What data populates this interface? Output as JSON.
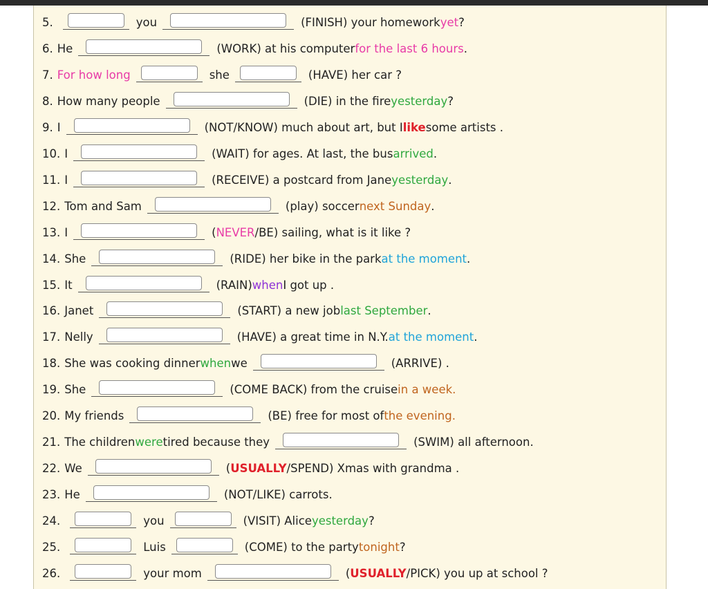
{
  "colors": {
    "pink": "#e83ba7",
    "red": "#e0212b",
    "green": "#2fa83f",
    "brown": "#c0651f",
    "blue": "#1fa3d9",
    "purple": "#8e32d6"
  },
  "exercises": [
    {
      "num": "5.",
      "parts": [
        {
          "blank": true,
          "w": "s"
        },
        {
          "t": "you"
        },
        {
          "blank": true
        },
        {
          "t": "(FINISH)  your homework "
        },
        {
          "t": "yet",
          "c": "pink"
        },
        {
          "t": " ?"
        }
      ]
    },
    {
      "num": "6.",
      "parts": [
        {
          "t": "He"
        },
        {
          "blank": true
        },
        {
          "t": "(WORK)  at his computer "
        },
        {
          "t": "for the last 6 hours",
          "c": "pink"
        },
        {
          "t": " ."
        }
      ]
    },
    {
      "num": "7.",
      "parts": [
        {
          "t": "For how long",
          "c": "pink"
        },
        {
          "blank": true,
          "w": "s"
        },
        {
          "t": "she"
        },
        {
          "blank": true,
          "w": "s"
        },
        {
          "t": "(HAVE)  her car ?"
        }
      ]
    },
    {
      "num": "8.",
      "parts": [
        {
          "t": "How many people"
        },
        {
          "blank": true
        },
        {
          "t": "(DIE)  in the fire "
        },
        {
          "t": "yesterday",
          "c": "green"
        },
        {
          "t": " ?"
        }
      ]
    },
    {
      "num": "9.",
      "parts": [
        {
          "t": "I"
        },
        {
          "blank": true
        },
        {
          "t": "(NOT/KNOW)  much about art, but I "
        },
        {
          "t": "like",
          "c": "red"
        },
        {
          "t": " some artists ."
        }
      ]
    },
    {
      "num": "10.",
      "parts": [
        {
          "t": "I"
        },
        {
          "blank": true
        },
        {
          "t": "(WAIT)  for ages. At last, the bus "
        },
        {
          "t": "arrived",
          "c": "green"
        },
        {
          "t": " ."
        }
      ]
    },
    {
      "num": "11.",
      "parts": [
        {
          "t": "I"
        },
        {
          "blank": true
        },
        {
          "t": "(RECEIVE)  a postcard from Jane "
        },
        {
          "t": "yesterday",
          "c": "green"
        },
        {
          "t": " ."
        }
      ]
    },
    {
      "num": "12.",
      "parts": [
        {
          "t": "Tom and Sam"
        },
        {
          "blank": true
        },
        {
          "t": "(play)  soccer "
        },
        {
          "t": "next Sunday",
          "c": "brown"
        },
        {
          "t": " ."
        }
      ]
    },
    {
      "num": "13.",
      "parts": [
        {
          "t": "I"
        },
        {
          "blank": true
        },
        {
          "t": "("
        },
        {
          "t": "NEVER",
          "c": "pink"
        },
        {
          "t": "/BE)  sailing, what is it like ?"
        }
      ]
    },
    {
      "num": "14.",
      "parts": [
        {
          "t": "She"
        },
        {
          "blank": true
        },
        {
          "t": "(RIDE)  her bike in the park "
        },
        {
          "t": "at the moment",
          "c": "blue"
        },
        {
          "t": " ."
        }
      ]
    },
    {
      "num": "15.",
      "parts": [
        {
          "t": "It"
        },
        {
          "blank": true
        },
        {
          "t": "(RAIN)  "
        },
        {
          "t": "when",
          "c": "purple"
        },
        {
          "t": " I got up ."
        }
      ]
    },
    {
      "num": "16.",
      "parts": [
        {
          "t": "Janet"
        },
        {
          "blank": true
        },
        {
          "t": "(START)  a new job "
        },
        {
          "t": "last September",
          "c": "green"
        },
        {
          "t": " ."
        }
      ]
    },
    {
      "num": "17.",
      "parts": [
        {
          "t": "Nelly"
        },
        {
          "blank": true
        },
        {
          "t": "(HAVE)  a great time in N.Y. "
        },
        {
          "t": "at the moment",
          "c": "blue"
        },
        {
          "t": " ."
        }
      ]
    },
    {
      "num": "18.",
      "parts": [
        {
          "t": "She was cooking dinner "
        },
        {
          "t": "when",
          "c": "green"
        },
        {
          "t": " we"
        },
        {
          "blank": true
        },
        {
          "t": "(ARRIVE) ."
        }
      ]
    },
    {
      "num": "19.",
      "parts": [
        {
          "t": "She"
        },
        {
          "blank": true
        },
        {
          "t": "(COME BACK)  from the cruise "
        },
        {
          "t": "in a week.",
          "c": "brown"
        }
      ]
    },
    {
      "num": "20.",
      "parts": [
        {
          "t": "My friends"
        },
        {
          "blank": true
        },
        {
          "t": "(BE)  free for most of "
        },
        {
          "t": "the evening.",
          "c": "brown"
        }
      ]
    },
    {
      "num": "21.",
      "parts": [
        {
          "t": "The children "
        },
        {
          "t": "were",
          "c": "green"
        },
        {
          "t": " tired because they"
        },
        {
          "blank": true
        },
        {
          "t": "(SWIM)  all afternoon."
        }
      ]
    },
    {
      "num": "22.",
      "parts": [
        {
          "t": "We"
        },
        {
          "blank": true
        },
        {
          "t": "("
        },
        {
          "t": "USUALLY",
          "c": "red"
        },
        {
          "t": "/SPEND)  Xmas with grandma ."
        }
      ]
    },
    {
      "num": "23.",
      "parts": [
        {
          "t": "He"
        },
        {
          "blank": true
        },
        {
          "t": "(NOT/LIKE)  carrots."
        }
      ]
    },
    {
      "num": "24.",
      "parts": [
        {
          "blank": true,
          "w": "s"
        },
        {
          "t": "you"
        },
        {
          "blank": true,
          "w": "s"
        },
        {
          "t": "(VISIT) Alice "
        },
        {
          "t": "yesterday",
          "c": "green"
        },
        {
          "t": " ?"
        }
      ]
    },
    {
      "num": "25.",
      "parts": [
        {
          "blank": true,
          "w": "s"
        },
        {
          "t": "Luis"
        },
        {
          "blank": true,
          "w": "s"
        },
        {
          "t": "(COME)  to the party "
        },
        {
          "t": "tonight",
          "c": "brown"
        },
        {
          "t": " ?"
        }
      ]
    },
    {
      "num": "26.",
      "parts": [
        {
          "blank": true,
          "w": "s"
        },
        {
          "t": "your mom"
        },
        {
          "blank": true
        },
        {
          "t": "("
        },
        {
          "t": "USUALLY",
          "c": "red"
        },
        {
          "t": "/PICK)  you up at school ?"
        }
      ]
    }
  ]
}
